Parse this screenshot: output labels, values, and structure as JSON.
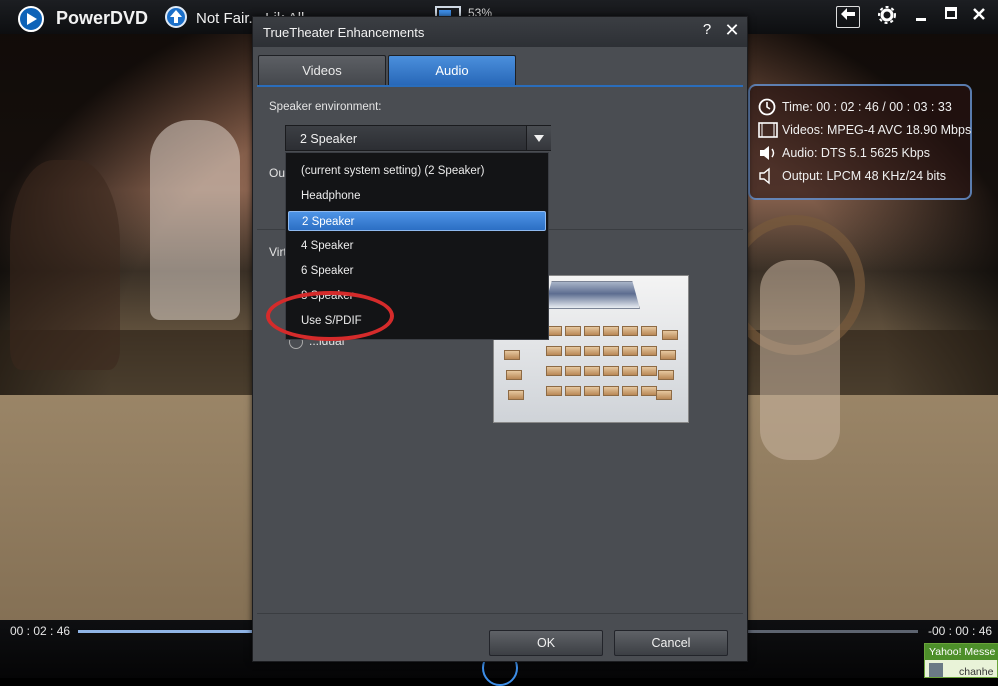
{
  "player": {
    "app_name": "PowerDVD",
    "movie_title": "Not Fair... Lik All",
    "battery_percent": "53%",
    "current_time": "00 : 02 : 46",
    "remaining_time": "-00 : 00 : 46",
    "progress_fraction": 0.5,
    "controls": {
      "back": "back-icon",
      "settings": "gear-icon",
      "minimize": "minimize-icon",
      "maximize": "maximize-icon",
      "close": "close-icon"
    }
  },
  "info_overlay": {
    "time": "Time: 00 : 02 : 46 / 00 : 03 : 33",
    "video": "Videos: MPEG-4 AVC  18.90 Mbps",
    "audio": "Audio: DTS 5.1  5625 Kbps",
    "output": "Output: LPCM 48 KHz/24 bits"
  },
  "dialog": {
    "title": "TrueTheater Enhancements",
    "help_label": "?",
    "close_label": "✕",
    "tabs": [
      {
        "label": "Videos",
        "active": false
      },
      {
        "label": "Audio",
        "active": true
      }
    ],
    "speaker_env_label": "Speaker environment:",
    "speaker_env_value": "2 Speaker",
    "output_label_partial": "Ou",
    "virtual_label_partial": "Virt",
    "radio_label_partial": "...idual",
    "dropdown_options": [
      {
        "label": "(current system setting) (2 Speaker)",
        "selected": false
      },
      {
        "label": "Headphone",
        "selected": false
      },
      {
        "label": "2 Speaker",
        "selected": true
      },
      {
        "label": "4 Speaker",
        "selected": false
      },
      {
        "label": "6 Speaker",
        "selected": false
      },
      {
        "label": "8 Speaker",
        "selected": false
      },
      {
        "label": "Use S/PDIF",
        "selected": false
      }
    ],
    "ok_label": "OK",
    "cancel_label": "Cancel"
  },
  "taskbar_popup": {
    "title": "Yahoo! Messe",
    "name": "chanhe"
  },
  "colors": {
    "accent": "#2c6fc4",
    "highlight_circle": "#d52b2b",
    "dialog_bg": "#4a4d52"
  }
}
